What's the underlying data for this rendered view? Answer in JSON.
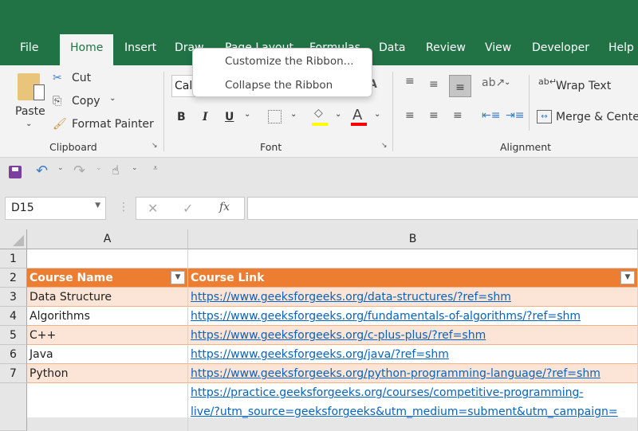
{
  "tabs": [
    "File",
    "Home",
    "Insert",
    "Draw",
    "Page Layout",
    "Formulas",
    "Data",
    "Review",
    "View",
    "Developer",
    "Help"
  ],
  "context_menu": {
    "items": [
      "Customize the Ribbon...",
      "Collapse the Ribbon"
    ]
  },
  "clipboard": {
    "paste": "Paste",
    "cut": "Cut",
    "copy": "Copy",
    "format_painter": "Format Painter",
    "label": "Clipboard"
  },
  "font": {
    "name_partial": "Cal",
    "bold": "B",
    "italic": "I",
    "underline": "U",
    "label": "Font",
    "fill_color": "#ffff00",
    "font_color": "#ff0000"
  },
  "alignment": {
    "wrap_text": "Wrap Text",
    "merge_center": "Merge & Center",
    "label": "Alignment"
  },
  "formula_bar": {
    "name_box": "D15",
    "fx": "fx",
    "cancel": "✕",
    "enter": "✓",
    "value": ""
  },
  "columns": [
    "A",
    "B"
  ],
  "rows": [
    {
      "num": "1",
      "a": "",
      "b": ""
    },
    {
      "num": "2",
      "a": "Course Name",
      "b": "Course Link"
    },
    {
      "num": "3",
      "a": "Data Structure",
      "b": "https://www.geeksforgeeks.org/data-structures/?ref=shm"
    },
    {
      "num": "4",
      "a": "Algorithms",
      "b": "https://www.geeksforgeeks.org/fundamentals-of-algorithms/?ref=shm"
    },
    {
      "num": "5",
      "a": "C++",
      "b": "https://www.geeksforgeeks.org/c-plus-plus/?ref=shm"
    },
    {
      "num": "6",
      "a": "Java",
      "b": "https://www.geeksforgeeks.org/java/?ref=shm"
    },
    {
      "num": "7",
      "a": "Python",
      "b": "https://www.geeksforgeeks.org/python-programming-language/?ref=shm"
    },
    {
      "num": "",
      "a": "",
      "b1": "https://practice.geeksforgeeks.org/courses/competitive-programming-",
      "b2": "live/?utm_source=geeksforgeeks&utm_medium=subment&utm_campaign="
    }
  ]
}
